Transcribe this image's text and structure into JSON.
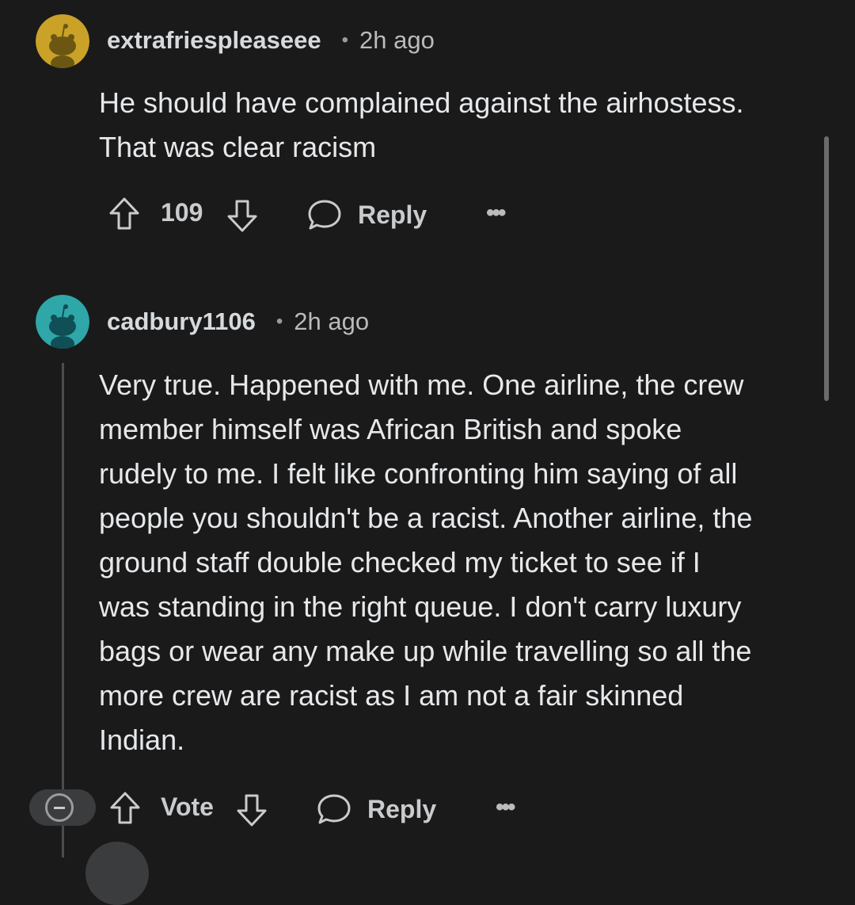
{
  "comments": [
    {
      "username": "extrafriespleaseee",
      "dot": "•",
      "time": "2h ago",
      "avatar_color": "#c9a227",
      "lines": [
        "He should have complained against the airhostess.",
        "That was clear racism"
      ],
      "vote_label": "109",
      "reply_label": "Reply",
      "more_label": "•••"
    },
    {
      "username": "cadbury1106",
      "dot": "•",
      "time": "2h ago",
      "avatar_color": "#2fa6a8",
      "lines": [
        "Very true. Happened with me. One airline, the crew",
        "member himself was African British and spoke",
        "rudely to me. I felt like confronting him saying of all",
        "people you shouldn't be a racist. Another airline, the",
        "ground staff double checked my ticket to see if I",
        "was standing in the right queue. I don't carry luxury",
        "bags or wear any make up while travelling so all the",
        "more crew are racist as I am not a fair skinned",
        "Indian."
      ],
      "vote_label": "Vote",
      "reply_label": "Reply",
      "more_label": "•••"
    }
  ],
  "icons": {
    "upvote": "arrow-up-icon",
    "downvote": "arrow-down-icon",
    "reply": "speech-bubble-icon",
    "more": "more-dots-icon",
    "collapse": "collapse-minus-icon"
  }
}
